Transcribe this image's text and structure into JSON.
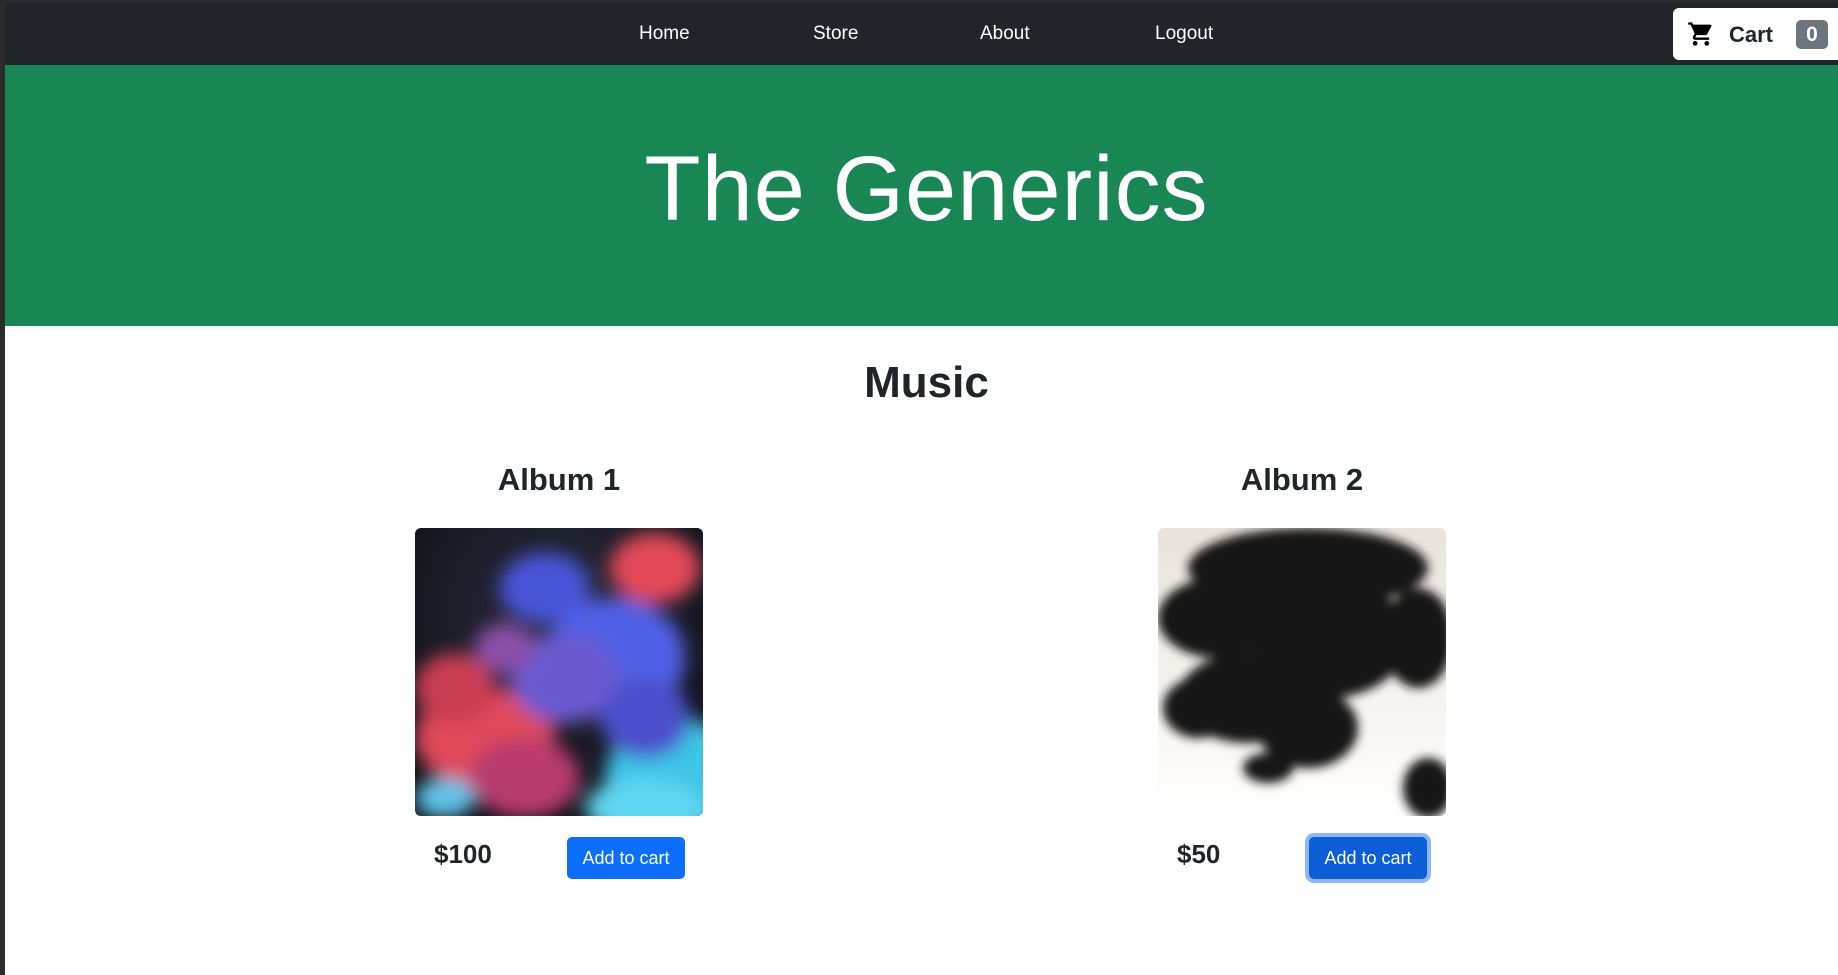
{
  "nav": {
    "links": [
      "Home",
      "Store",
      "About",
      "Logout"
    ],
    "cart_label": "Cart",
    "cart_count": "0"
  },
  "hero": {
    "title": "The Generics"
  },
  "music": {
    "title": "Music",
    "albums": [
      {
        "title": "Album 1",
        "price": "$100",
        "button": "Add to cart"
      },
      {
        "title": "Album 2",
        "price": "$50",
        "button": "Add to cart"
      }
    ]
  },
  "colors": {
    "navbar": "#212529",
    "hero": "#198754",
    "primary_button": "#0d6efd",
    "badge": "#6c757d"
  },
  "icons": {
    "cart": "shopping-cart-icon"
  }
}
